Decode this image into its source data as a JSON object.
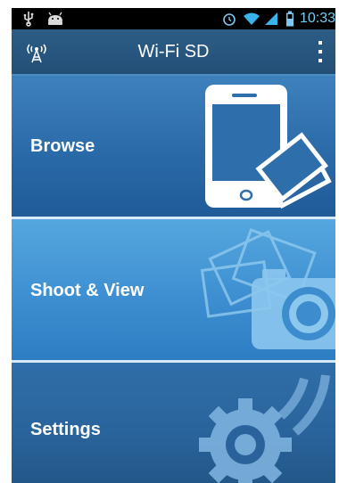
{
  "status_bar": {
    "time": "10:33",
    "left_icons": [
      "usb-icon",
      "android-debug-icon"
    ],
    "right_icons": [
      "alarm-clock-icon",
      "wifi-icon",
      "signal-icon",
      "battery-icon"
    ]
  },
  "action_bar": {
    "title": "Wi-Fi SD",
    "app_icon": "wireless-tower-icon",
    "menu_icon": "overflow-menu-icon"
  },
  "tiles": [
    {
      "label": "Browse",
      "icon": "phone-photos-icon"
    },
    {
      "label": "Shoot & View",
      "icon": "camera-photos-icon"
    },
    {
      "label": "Settings",
      "icon": "gear-wireless-icon"
    }
  ],
  "colors": {
    "status_bar": "#000000",
    "action_bar": "#2c5d86",
    "tile_browse": "#2a6aa8",
    "tile_shoot": "#3e8fd1",
    "tile_settings": "#2a639b",
    "time_text": "#6ecff6"
  }
}
